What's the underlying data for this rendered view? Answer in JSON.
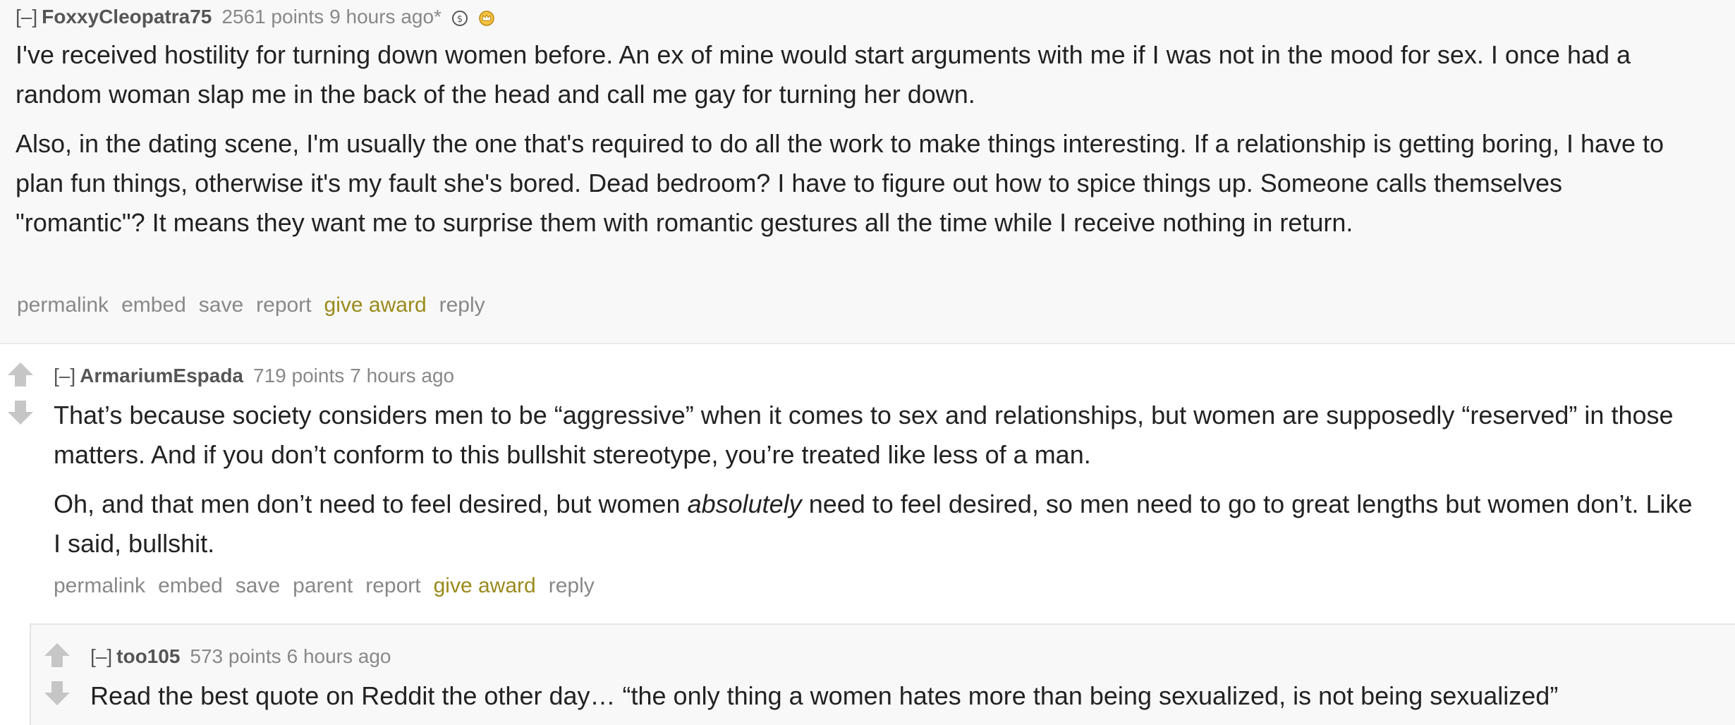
{
  "comments": [
    {
      "toggle": "[–]",
      "author": "FoxxyCleopatra75",
      "score": "2561 points",
      "time": "9 hours ago*",
      "awards": [
        "silver-coin-award-icon",
        "gold-crown-award-icon"
      ],
      "paragraphs": [
        "I've received hostility for turning down women before. An ex of mine would start arguments with me if I was not in the mood for sex. I once had a random woman slap me in the back of the head and call me gay for turning her down.",
        "Also, in the dating scene, I'm usually the one that's required to do all the work to make things interesting. If a relationship is getting boring, I have to plan fun things, otherwise it's my fault she's bored. Dead bedroom? I have to figure out how to spice things up. Someone calls themselves \"romantic\"? It means they want me to surprise them with romantic gestures all the time while I receive nothing in return."
      ],
      "buttons": {
        "permalink": "permalink",
        "embed": "embed",
        "save": "save",
        "report": "report",
        "give_award": "give award",
        "reply": "reply"
      }
    },
    {
      "toggle": "[–]",
      "author": "ArmariumEspada",
      "score": "719 points",
      "time": "7 hours ago",
      "paragraphs": [
        "That’s because society considers men to be “aggressive” when it comes to sex and relationships, but women are supposedly “reserved” in those matters. And if you don’t conform to this bullshit stereotype, you’re treated like less of a man."
      ],
      "paragraph2": {
        "before": "Oh, and that men don’t need to feel desired, but women ",
        "emphasis": "absolutely",
        "after": " need to feel desired, so men need to go to great lengths but women don’t. Like I said, bullshit."
      },
      "buttons": {
        "permalink": "permalink",
        "embed": "embed",
        "save": "save",
        "parent": "parent",
        "report": "report",
        "give_award": "give award",
        "reply": "reply"
      }
    },
    {
      "toggle": "[–]",
      "author": "too105",
      "score": "573 points",
      "time": "6 hours ago",
      "paragraphs": [
        "Read the best quote on Reddit the other day… “the only thing a women hates more than being sexualized, is not being sexualized”"
      ]
    }
  ],
  "colors": {
    "award_link": "#9a8a1c",
    "muted": "#888888",
    "author": "#555555",
    "comment_bg": "#f8f8f8",
    "vote_arrow": "#c6c6c6"
  }
}
